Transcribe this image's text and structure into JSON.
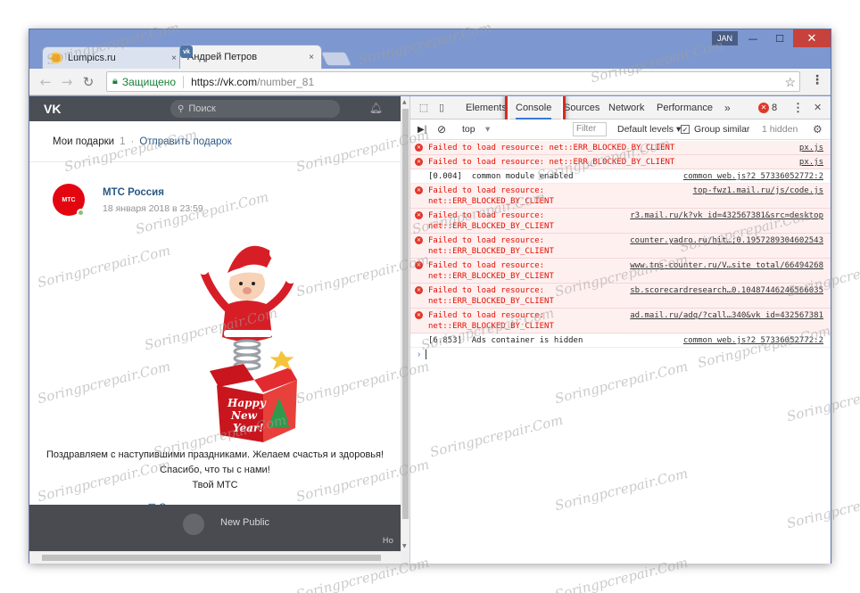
{
  "window": {
    "user": "JAN",
    "controls": {
      "minimize": "—",
      "maximize": "☐",
      "close": "✕"
    }
  },
  "tabs": [
    {
      "label": "Lumpics.ru",
      "close": "×"
    },
    {
      "label": "Андрей Петров",
      "close": "×"
    }
  ],
  "toolbar": {
    "back": "←",
    "forward": "→",
    "reload": "↻",
    "secure_label": "Защищено",
    "url_host": "https://vk.com",
    "url_path": "/number_81",
    "star": "☆",
    "menu": "⋮"
  },
  "vk": {
    "logo": "VK",
    "search_placeholder": "Поиск",
    "gifts_title": "Мои подарки",
    "gifts_count": "1",
    "gifts_dot": "·",
    "gifts_send": "Отправить подарок",
    "avatar_label": "МТС",
    "author": "МТС Россия",
    "date": "18 января 2018 в 23:59",
    "message_lines": [
      "Поздравляем с наступившими праздниками. Желаем счастья и здоровья!",
      "Спасибо, что ты с нами!",
      "Твой МТС"
    ],
    "reply_icon": "⊞",
    "reply_link": "Отправить подарок в ответ",
    "gift_text": [
      "Happy",
      "New",
      "Year!"
    ],
    "new_public": "New Public",
    "corner_text": "Но"
  },
  "devtools": {
    "tabs": [
      "Elements",
      "Console",
      "Sources",
      "Network",
      "Performance"
    ],
    "active_tab": "Console",
    "more": "»",
    "error_count": "8",
    "kebab": "⋮",
    "close": "✕",
    "filterbar": {
      "context": "top",
      "filter_placeholder": "Filter",
      "levels": "Default levels ▾",
      "group_similar": "Group similar",
      "hidden": "1 hidden"
    },
    "rows": [
      {
        "type": "error",
        "text": "Failed to load resource: net::ERR_BLOCKED_BY_CLIENT",
        "source": "px.js"
      },
      {
        "type": "error",
        "text": "Failed to load resource: net::ERR_BLOCKED_BY_CLIENT",
        "source": "px.js"
      },
      {
        "type": "info",
        "text": "[0.004]  common module enabled",
        "source": "common_web.js?2_57336052772:2"
      },
      {
        "type": "error",
        "text": "Failed to load resource:\nnet::ERR_BLOCKED_BY_CLIENT",
        "source": "top-fwz1.mail.ru/js/code.js"
      },
      {
        "type": "error",
        "text": "Failed to load resource:\nnet::ERR_BLOCKED_BY_CLIENT",
        "source": "r3.mail.ru/k?vk_id=432567381&src=desktop"
      },
      {
        "type": "error",
        "text": "Failed to load resource:\nnet::ERR_BLOCKED_BY_CLIENT",
        "source": "counter.yadro.ru/hit…;0.1957289304602543"
      },
      {
        "type": "error",
        "text": "Failed to load resource:\nnet::ERR_BLOCKED_BY_CLIENT",
        "source": "www.tns-counter.ru/V…site_total/66494268"
      },
      {
        "type": "error",
        "text": "Failed to load resource:\nnet::ERR_BLOCKED_BY_CLIENT",
        "source": "sb.scorecardresearch…0.10487446246566035"
      },
      {
        "type": "error",
        "text": "Failed to load resource:\nnet::ERR_BLOCKED_BY_CLIENT",
        "source": "ad.mail.ru/adq/?call…340&vk_id=432567381"
      },
      {
        "type": "info",
        "text": "[6.853]  Ads container is hidden",
        "source": "common_web.js?2_57336052772:2"
      }
    ],
    "prompt": "›"
  },
  "watermark": "Soringpcrepair.Com",
  "colors": {
    "accent": "#3879d9",
    "error": "#e00f00",
    "highlight": "#d72b23",
    "vk_link": "#2a5885"
  }
}
